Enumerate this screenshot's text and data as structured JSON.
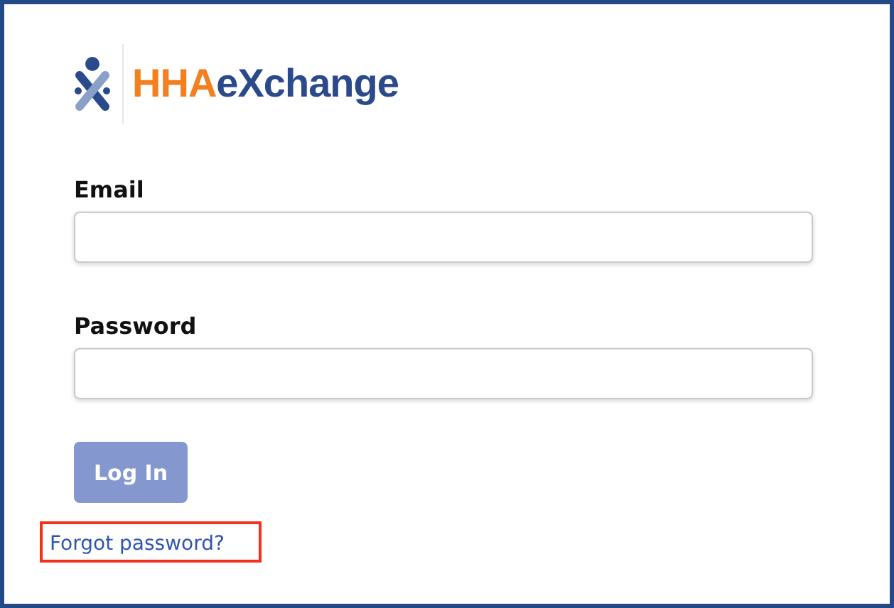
{
  "logo": {
    "brand": "HHA",
    "suffix": "eXchange"
  },
  "fields": [
    {
      "label": "Email"
    },
    {
      "label": "Password"
    }
  ],
  "login_button": {
    "label": "Log In",
    "disabled": true
  },
  "forgot_link": {
    "label": "Forgot password?",
    "highlighted": true
  }
}
